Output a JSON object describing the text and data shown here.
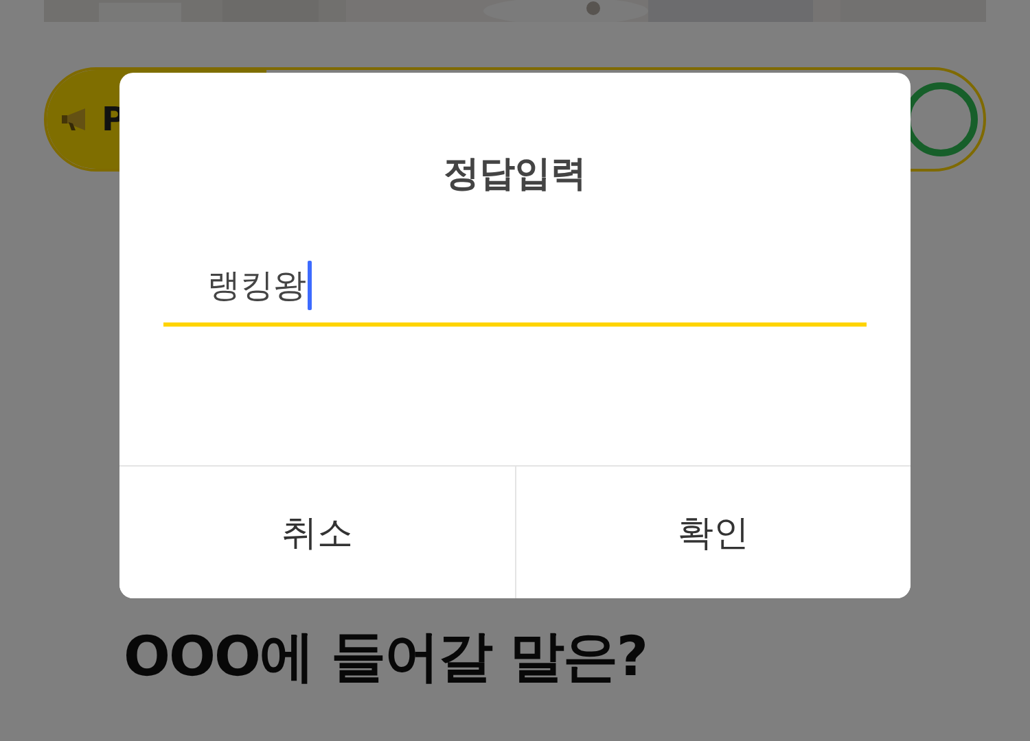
{
  "banner": {
    "label": "P"
  },
  "question": "OOO에 들어갈 말은?",
  "dialog": {
    "title": "정답입력",
    "input": {
      "value": "랭킹왕",
      "focused": true
    },
    "buttons": [
      {
        "label": "취소"
      },
      {
        "label": "확인"
      }
    ]
  }
}
